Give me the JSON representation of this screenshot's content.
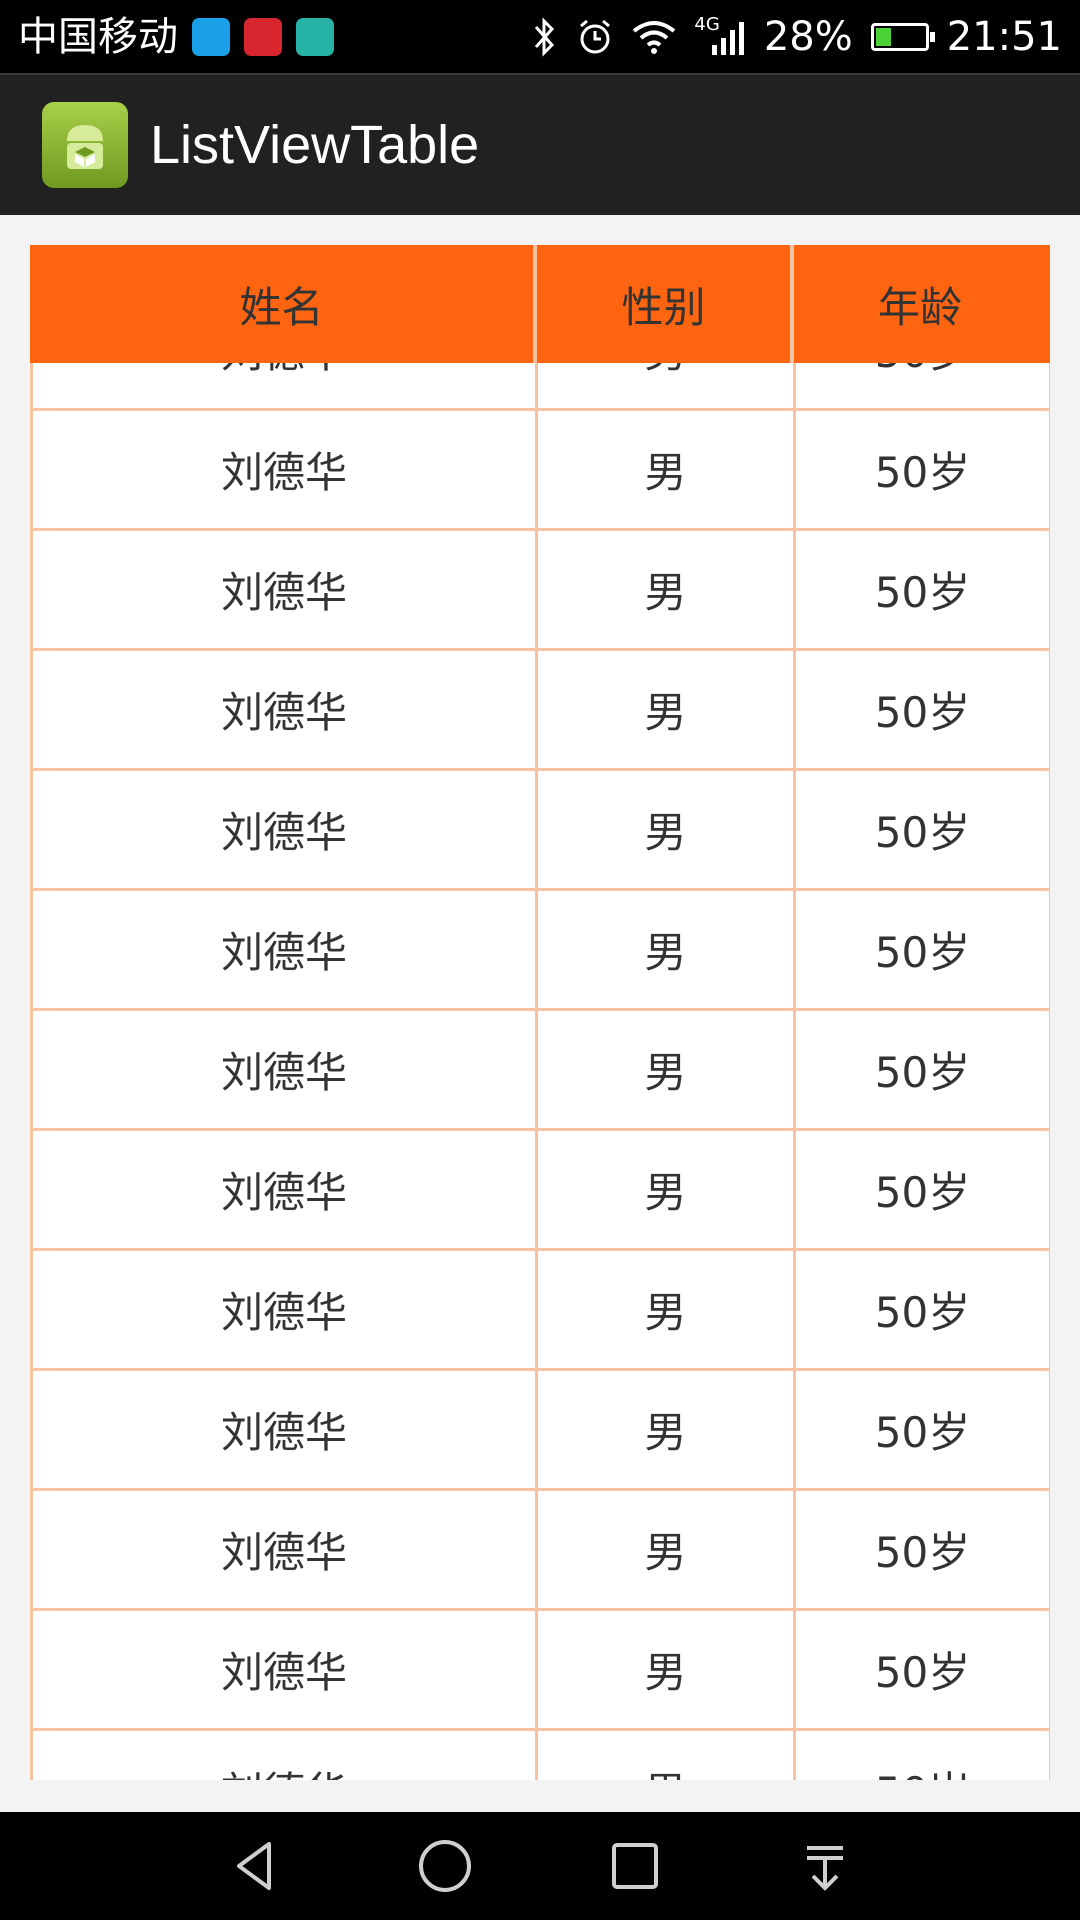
{
  "status_bar": {
    "carrier": "中国移动",
    "network": "4G",
    "battery": "28%",
    "time": "21:51",
    "notification_icons": [
      "cloud-icon",
      "huawei-icon",
      "android-icon"
    ]
  },
  "action_bar": {
    "title": "ListViewTable"
  },
  "table": {
    "headers": [
      "姓名",
      "性别",
      "年龄"
    ],
    "rows": [
      [
        "刘德华",
        "男",
        "50岁"
      ],
      [
        "刘德华",
        "男",
        "50岁"
      ],
      [
        "刘德华",
        "男",
        "50岁"
      ],
      [
        "刘德华",
        "男",
        "50岁"
      ],
      [
        "刘德华",
        "男",
        "50岁"
      ],
      [
        "刘德华",
        "男",
        "50岁"
      ],
      [
        "刘德华",
        "男",
        "50岁"
      ],
      [
        "刘德华",
        "男",
        "50岁"
      ],
      [
        "刘德华",
        "男",
        "50岁"
      ],
      [
        "刘德华",
        "男",
        "50岁"
      ],
      [
        "刘德华",
        "男",
        "50岁"
      ],
      [
        "刘德华",
        "男",
        "50岁"
      ],
      [
        "",
        "",
        ""
      ]
    ]
  },
  "colors": {
    "header_bg": "#ff6510",
    "grid_line": "#f8c3a0"
  }
}
